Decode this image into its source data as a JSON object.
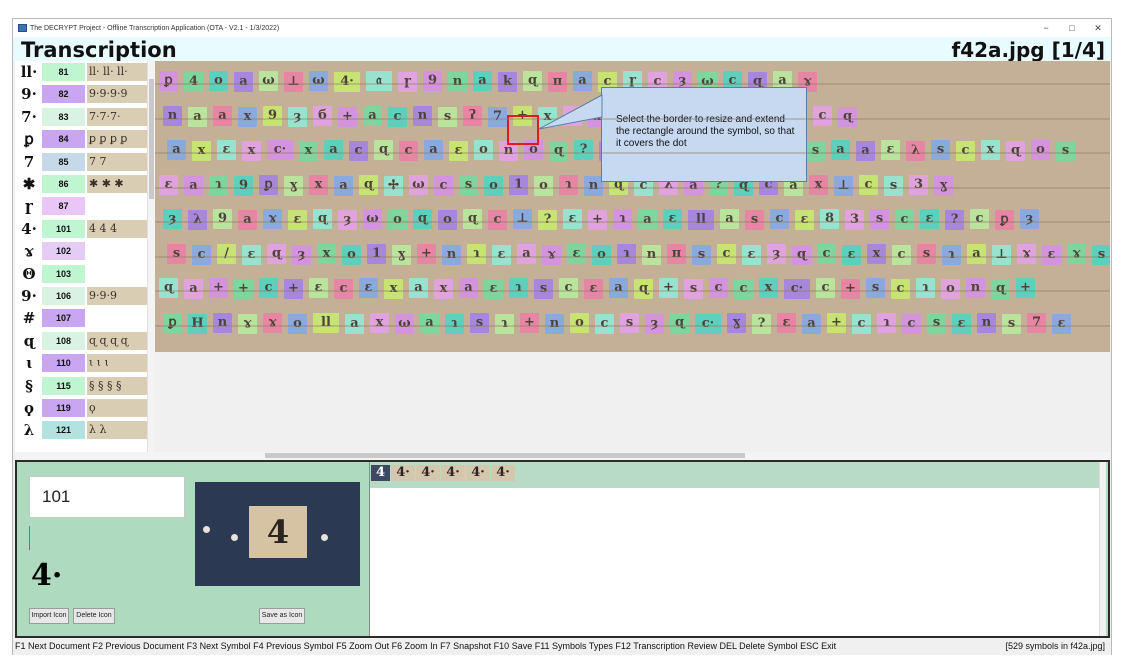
{
  "window": {
    "title": "The DECRYPT Project - Offline Transcription Application (OTA - V2.1 - 1/3/2022)",
    "minimize": "−",
    "maximize": "□",
    "close": "✕"
  },
  "header": {
    "title": "Transcription",
    "file": "f42a.jpg [1/4]"
  },
  "symbols": [
    {
      "glyph": "ll·",
      "code": "81",
      "color": "#c0f5d2",
      "sample": "ll· ll· ll·"
    },
    {
      "glyph": "9·",
      "code": "82",
      "color": "#c8a6f2",
      "sample": "9·9·9·9"
    },
    {
      "glyph": "7·",
      "code": "83",
      "color": "#d9f2e2",
      "sample": "7·7·7·"
    },
    {
      "glyph": "ꝑ",
      "code": "84",
      "color": "#c8a6f2",
      "sample": "ꝑ ꝑ ꝑ ꝑ"
    },
    {
      "glyph": "7",
      "code": "85",
      "color": "#c6d9e8",
      "sample": "7 7"
    },
    {
      "glyph": "✱",
      "code": "86",
      "color": "#c0f5d2",
      "sample": "✱ ✱ ✱"
    },
    {
      "glyph": "ɼ",
      "code": "87",
      "color": "#e8c6f5",
      "sample": ""
    },
    {
      "glyph": "4·",
      "code": "101",
      "color": "#c0f5d2",
      "sample": "4 4 4"
    },
    {
      "glyph": "ɤ",
      "code": "102",
      "color": "#e3cdf7",
      "sample": ""
    },
    {
      "glyph": "Θ",
      "code": "103",
      "color": "#c0f5d2",
      "sample": ""
    },
    {
      "glyph": "9·",
      "code": "106",
      "color": "#d9f2e2",
      "sample": "9·9·9"
    },
    {
      "glyph": "#",
      "code": "107",
      "color": "#c8a6f2",
      "sample": ""
    },
    {
      "glyph": "ɋ",
      "code": "108",
      "color": "#d9f2e2",
      "sample": "ɋ ɋ ɋ ɋ"
    },
    {
      "glyph": "ɩ",
      "code": "110",
      "color": "#c8a6f2",
      "sample": "ɩ ɩ ɩ"
    },
    {
      "glyph": "§",
      "code": "115",
      "color": "#c0f5d2",
      "sample": "§ § § §"
    },
    {
      "glyph": "ϙ",
      "code": "119",
      "color": "#c8a6f2",
      "sample": "ϙ"
    },
    {
      "glyph": "λ",
      "code": "121",
      "color": "#b2e3e0",
      "sample": "λ λ"
    }
  ],
  "manuscript_rows": [
    "ꝑ 4 o a ω ⊥ ω 4· 𝔞 ɼ 9 n a k ɋ π a c ɼ c ȝ ω c ɋ a ɤ",
    "n a a x 9 ȝ б + a c n s ʔ 7 + x a x c ɋ ω ɋ ? x ɿ o c ɋ",
    "a x ɛ x c· x a c ɋ c a ɛ o n o ɋ ? ll б ω c ɋ ɛ ɛ c s a a ɛ λ s c x ɋ o s",
    "ɛ a ɿ 9 ꝑ ɣ x a ɋ ✢ ω c s o 1 o ɿ n ɋ c λ a ? ɋ c a x ⊥ c s 3 ɣ",
    "ȝ λ 9 a ɤ ɛ ɋ ȝ ω o ɋ o ɋ c ⊥ ? ɛ + ɿ a ɛ ll a s c ɛ 8 3 s c ɛ ? c ꝑ ȝ",
    "s c / ɛ ɋ ȝ x o 1 ɣ + n ɿ ɛ a ɤ ɛ o ɿ n π s c ɛ ȝ ɋ c ɛ x c s ɿ a ⊥ ɤ ɛ ɤ s",
    "ɋ a + + c + ɛ c ɛ x a x a ɛ ɿ s c ɛ a ɋ + s c c x c· c + s c ɿ o n ɋ +",
    "ꝑ H n ɤ ɤ o ll a x ω a ɿ s ɿ + n o c s ȝ ɋ c· ɣ ? ɛ a + c ɿ c s ɛ n s 7 ɛ"
  ],
  "callout": {
    "text": "Select the border to resize and extend the rectangle around the symbol, so that it covers the dot"
  },
  "detail": {
    "code_value": "101",
    "glyph": "4·",
    "preview_glyph": "4",
    "import_label": "Import Icon",
    "delete_label": "Delete Icon",
    "save_label": "Save as Icon"
  },
  "results": {
    "samples": [
      "4",
      "4·",
      "4·",
      "4·",
      "4·",
      "4·"
    ]
  },
  "status": {
    "keys": "F1 Next Document F2 Previous Document F3 Next Symbol F4 Previous Symbol F5 Zoom Out F6 Zoom In F7 Snapshot F10 Save F11 Symbols Types F12 Transcription Review DEL Delete Symbol ESC Exit",
    "count": "[529 symbols in f42a.jpg]"
  },
  "colors": {
    "box_palette": [
      "#d98cf2",
      "#6be0a0",
      "#3fd9c9",
      "#9f7bf2",
      "#b8f2a0",
      "#f27ba8",
      "#7ba8f2",
      "#c9f26b",
      "#8cf2e0",
      "#e8a0f2"
    ]
  }
}
